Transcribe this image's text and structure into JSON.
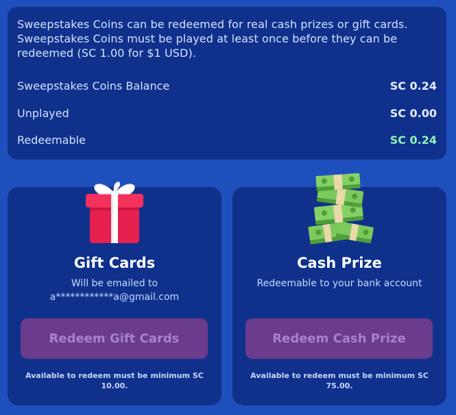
{
  "info": {
    "description": "Sweepstakes Coins can be redeemed for real cash prizes or gift cards. Sweepstakes Coins must be played at least once before they can be redeemed (SC 1.00 for $1 USD).",
    "rows": [
      {
        "label": "Sweepstakes Coins Balance",
        "value": "SC 0.24"
      },
      {
        "label": "Unplayed",
        "value": "SC 0.00"
      },
      {
        "label": "Redeemable",
        "value": "SC 0.24"
      }
    ]
  },
  "gift_card": {
    "title": "Gift Cards",
    "subtitle_line1": "Will be emailed to",
    "subtitle_line2": "a************a@gmail.com",
    "button_label": "Redeem Gift Cards",
    "note": "Available to redeem must be minimum SC 10.00."
  },
  "cash_prize": {
    "title": "Cash Prize",
    "subtitle_line1": "Redeemable to your bank account",
    "button_label": "Redeem Cash Prize",
    "note": "Available to redeem must be minimum SC 75.00."
  },
  "colors": {
    "background": "#1f4fbd",
    "panel": "#0f318c",
    "button": "#6b3b8c",
    "redeemable_value": "#8ff5b5"
  },
  "icons": [
    "gift-box-icon",
    "money-stack-icon"
  ]
}
